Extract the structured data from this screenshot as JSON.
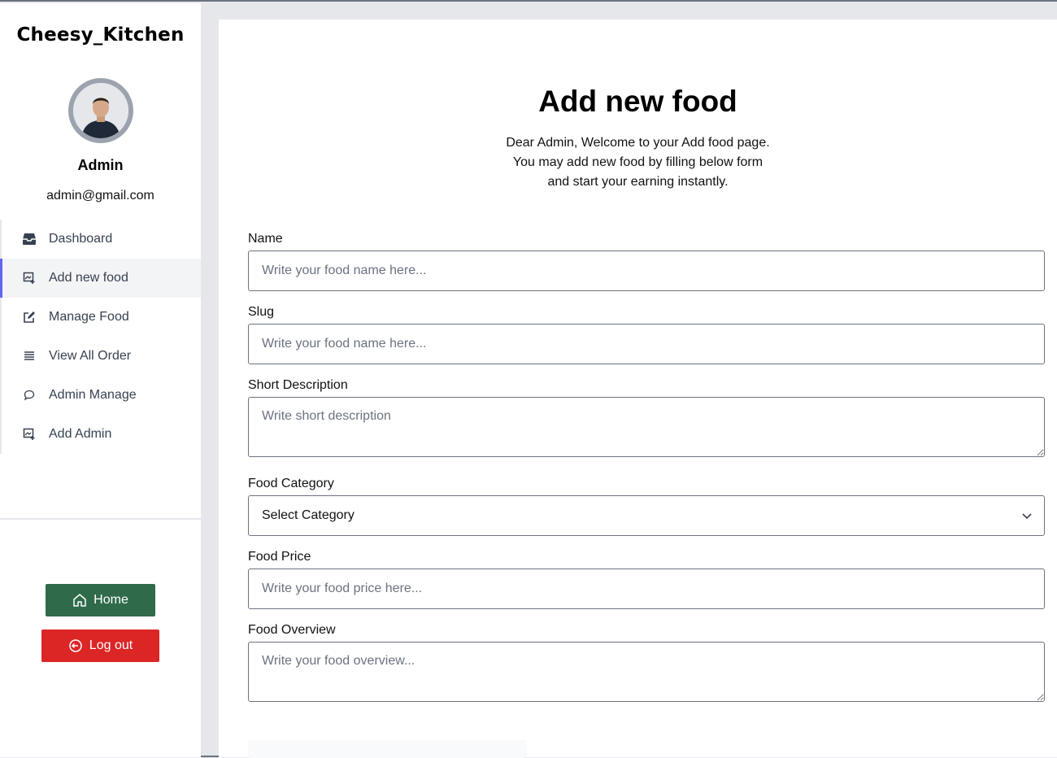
{
  "sidebar": {
    "brand": "Cheesy_Kitchen",
    "user": {
      "name": "Admin",
      "email": "admin@gmail.com"
    },
    "items": [
      {
        "label": "Dashboard",
        "icon": "inbox-tray-icon"
      },
      {
        "label": "Add new food",
        "icon": "add-image-icon",
        "active": true
      },
      {
        "label": "Manage Food",
        "icon": "edit-icon"
      },
      {
        "label": "View All Order",
        "icon": "list-icon"
      },
      {
        "label": "Admin Manage",
        "icon": "chat-bubble-icon"
      },
      {
        "label": "Add Admin",
        "icon": "add-image-icon"
      }
    ],
    "home_label": "Home",
    "logout_label": "Log out",
    "colors": {
      "home": "#2f6b4a",
      "logout": "#dc2626",
      "active_indicator": "#6366f1"
    }
  },
  "main": {
    "title": "Add new food",
    "subtitle": [
      "Dear Admin, Welcome to your Add food page.",
      "You may add new food by filling below form",
      "and start your earning instantly."
    ],
    "form": {
      "name": {
        "label": "Name",
        "placeholder": "Write your food name here..."
      },
      "slug": {
        "label": "Slug",
        "placeholder": "Write your food name here..."
      },
      "short_description": {
        "label": "Short Description",
        "placeholder": "Write short description"
      },
      "category": {
        "label": "Food Category",
        "selected": "Select Category"
      },
      "price": {
        "label": "Food Price",
        "placeholder": "Write your food price here..."
      },
      "overview": {
        "label": "Food Overview",
        "placeholder": "Write your food overview..."
      }
    }
  }
}
